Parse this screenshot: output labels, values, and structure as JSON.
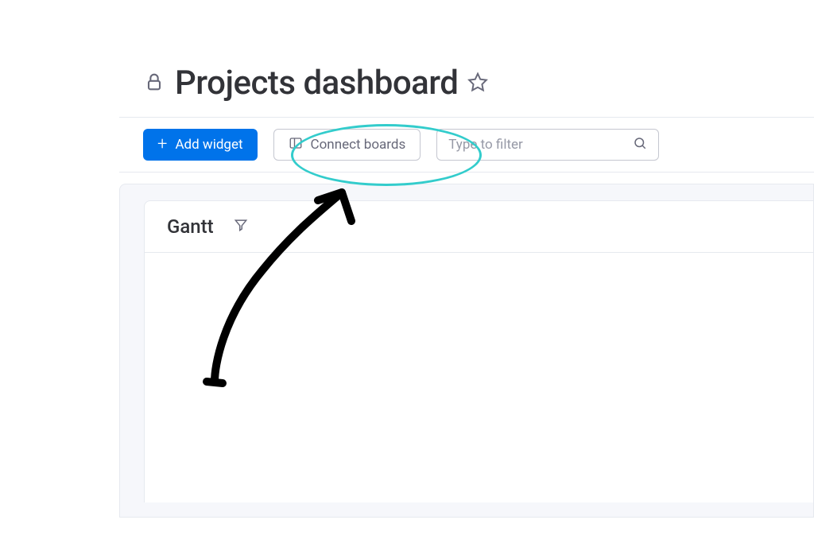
{
  "header": {
    "title": "Projects dashboard"
  },
  "toolbar": {
    "add_widget_label": "Add widget",
    "connect_boards_label": "Connect boards",
    "filter_placeholder": "Type to filter"
  },
  "widget": {
    "title": "Gantt"
  },
  "annotation": {
    "highlight_target": "connect-boards-button",
    "ellipse_color": "#33cccc"
  }
}
